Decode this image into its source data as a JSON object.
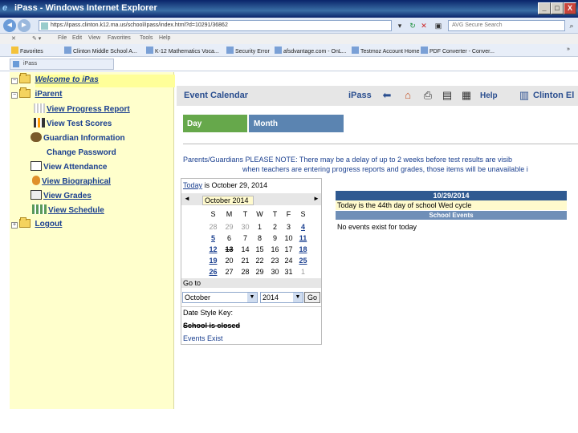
{
  "window": {
    "title": "iPass - Windows Internet Explorer",
    "minimize": "_",
    "maximize": "□",
    "close": "X"
  },
  "address": {
    "url": "https://ipass.clinton.k12.ma.us/school/ipass/index.html?d=10291/36862",
    "search_placeholder": "AVG Secure Search"
  },
  "menu": [
    "File",
    "Edit",
    "View",
    "Favorites",
    "Tools",
    "Help"
  ],
  "favorites": [
    "Favorites",
    "Clinton Middle School A...",
    "K-12 Mathematics Voca...",
    "Security Error",
    "afsdvantage.com - OnL...",
    "Testmoz Account Home",
    "PDF Converter - Conver..."
  ],
  "tab_title": "iPass",
  "tree": {
    "welcome": "Welcome to iPas",
    "iparent": "iParent",
    "items": [
      {
        "label": "View Progress Report",
        "bold": true,
        "underline": true
      },
      {
        "label": "View Test Scores",
        "bold": true,
        "underline": false
      },
      {
        "label": "Guardian Information",
        "bold": true,
        "underline": false
      },
      {
        "label": "Change Password",
        "bold": true,
        "underline": false
      },
      {
        "label": "View Attendance",
        "bold": true,
        "underline": false
      },
      {
        "label": "View Biographical",
        "bold": true,
        "underline": true
      },
      {
        "label": "View Grades",
        "bold": true,
        "underline": true
      },
      {
        "label": "View Schedule",
        "bold": true,
        "underline": true
      }
    ],
    "logout": "Logout"
  },
  "header": {
    "title": "Event Calendar",
    "ipass": "iPass",
    "help": "Help",
    "school": "Clinton El"
  },
  "tabs": {
    "day": "Day",
    "month": "Month"
  },
  "notice": {
    "line1": "Parents/Guardians PLEASE NOTE: There may be a delay of up to 2 weeks before test results are visib",
    "line2": "when teachers are entering progress reports and grades, those items will be unavailable i"
  },
  "calendar": {
    "today_link": "Today",
    "today_text": " is October 29, 2014",
    "prev": "◄",
    "next": "►",
    "month_label": "October 2014",
    "dow": [
      "S",
      "M",
      "T",
      "W",
      "T",
      "F",
      "S"
    ],
    "weeks": [
      [
        {
          "d": "28",
          "t": "other"
        },
        {
          "d": "29",
          "t": "other"
        },
        {
          "d": "30",
          "t": "other"
        },
        {
          "d": "1",
          "t": "normal"
        },
        {
          "d": "2",
          "t": "normal"
        },
        {
          "d": "3",
          "t": "normal"
        },
        {
          "d": "4",
          "t": "event"
        }
      ],
      [
        {
          "d": "5",
          "t": "event"
        },
        {
          "d": "6",
          "t": "normal"
        },
        {
          "d": "7",
          "t": "normal"
        },
        {
          "d": "8",
          "t": "normal"
        },
        {
          "d": "9",
          "t": "normal"
        },
        {
          "d": "10",
          "t": "normal"
        },
        {
          "d": "11",
          "t": "event"
        }
      ],
      [
        {
          "d": "12",
          "t": "event"
        },
        {
          "d": "13",
          "t": "closed"
        },
        {
          "d": "14",
          "t": "normal"
        },
        {
          "d": "15",
          "t": "normal"
        },
        {
          "d": "16",
          "t": "normal"
        },
        {
          "d": "17",
          "t": "normal"
        },
        {
          "d": "18",
          "t": "event"
        }
      ],
      [
        {
          "d": "19",
          "t": "event"
        },
        {
          "d": "20",
          "t": "normal"
        },
        {
          "d": "21",
          "t": "normal"
        },
        {
          "d": "22",
          "t": "normal"
        },
        {
          "d": "23",
          "t": "normal"
        },
        {
          "d": "24",
          "t": "normal"
        },
        {
          "d": "25",
          "t": "event"
        }
      ],
      [
        {
          "d": "26",
          "t": "event"
        },
        {
          "d": "27",
          "t": "normal"
        },
        {
          "d": "28",
          "t": "normal"
        },
        {
          "d": "29",
          "t": "normal"
        },
        {
          "d": "30",
          "t": "normal"
        },
        {
          "d": "31",
          "t": "normal"
        },
        {
          "d": "1",
          "t": "other"
        }
      ]
    ],
    "goto_label": "Go to",
    "month_select": "October",
    "year_select": "2014",
    "go_button": "Go",
    "key_title": "Date Style Key:",
    "key_closed": "School is closed",
    "key_events": "Events Exist"
  },
  "day_detail": {
    "date": "10/29/2014",
    "today_line": "Today is the 44th day of school Wed cycle",
    "events_header": "School Events",
    "no_events": "No events exist for today"
  },
  "colors": {
    "day_tab": "#66a84b",
    "month_tab": "#5b84b1",
    "tree_bg": "#ffffcc",
    "link": "#1a3f8f"
  }
}
